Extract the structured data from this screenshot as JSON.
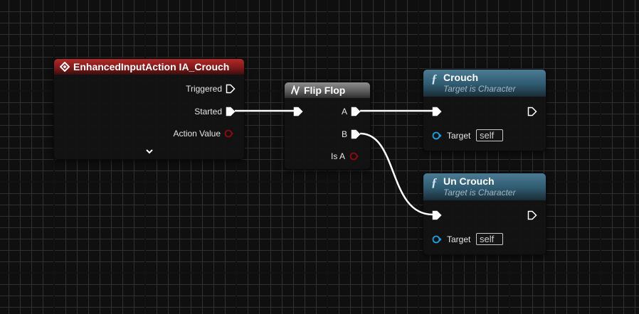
{
  "nodes": {
    "enhanced_input": {
      "title": "EnhancedInputAction IA_Crouch",
      "pins": {
        "triggered": "Triggered",
        "started": "Started",
        "action_value": "Action Value"
      },
      "header_color": "#8b1e1e"
    },
    "flip_flop": {
      "title": "Flip Flop",
      "pins": {
        "a": "A",
        "b": "B",
        "is_a": "Is A"
      },
      "header_color": "#6a6a6a"
    },
    "crouch": {
      "title": "Crouch",
      "subtitle": "Target is Character",
      "target_label": "Target",
      "target_value": "self",
      "header_color": "#3a6a84"
    },
    "un_crouch": {
      "title": "Un Crouch",
      "subtitle": "Target is Character",
      "target_label": "Target",
      "target_value": "self",
      "header_color": "#3a6a84"
    }
  },
  "colors": {
    "background": "#262626",
    "grid_major": "#0f0f0f",
    "exec_wire": "#ffffff",
    "bool_pin": "#8f0a0a",
    "object_pin": "#1ea0e6"
  },
  "icons": {
    "event": "event-diamond-icon",
    "flow": "flow-control-icon",
    "function": "function-f-icon",
    "expand": "chevron-down-icon"
  }
}
